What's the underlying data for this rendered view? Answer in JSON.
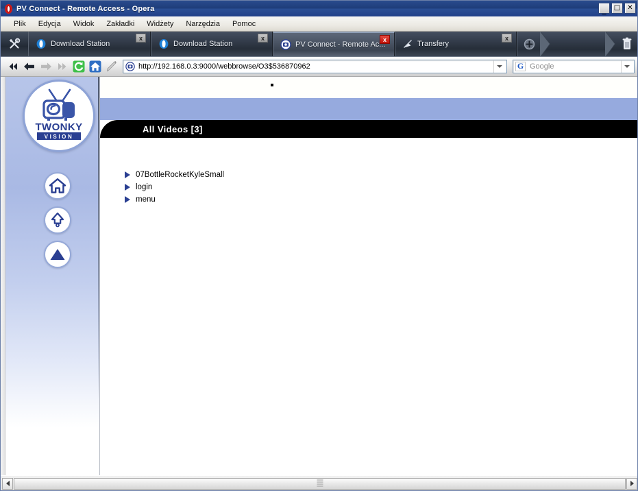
{
  "window": {
    "title": "PV Connect - Remote Access - Opera",
    "icon": "opera-logo-icon",
    "controls": {
      "minimize": "_",
      "maximize": "□",
      "close": "✕"
    }
  },
  "menubar": {
    "items": [
      {
        "label": "Plik"
      },
      {
        "label": "Edycja"
      },
      {
        "label": "Widok"
      },
      {
        "label": "Zakładki"
      },
      {
        "label": "Widżety"
      },
      {
        "label": "Narzędzia"
      },
      {
        "label": "Pomoc"
      }
    ]
  },
  "tabbar": {
    "tools_icon": "wrench-screwdriver-icon",
    "newtab_icon": "plus-circle-icon",
    "trash_icon": "trash-icon",
    "close_label": "x",
    "tabs": [
      {
        "label": "Download Station",
        "icon": "opera-favicon-icon",
        "active": false
      },
      {
        "label": "Download Station",
        "icon": "opera-favicon-icon",
        "active": false
      },
      {
        "label": "PV Connect - Remote Ac...",
        "icon": "twonky-favicon-icon",
        "active": true
      },
      {
        "label": "Transfery",
        "icon": "satellite-dish-icon",
        "active": false
      }
    ]
  },
  "navbar": {
    "buttons": [
      {
        "name": "rewind-button",
        "icon": "double-left-arrow-icon",
        "enabled": true
      },
      {
        "name": "back-button",
        "icon": "left-arrow-icon",
        "enabled": true
      },
      {
        "name": "forward-button",
        "icon": "right-arrow-icon",
        "enabled": false
      },
      {
        "name": "fast-forward-button",
        "icon": "double-right-arrow-icon",
        "enabled": false
      },
      {
        "name": "reload-button",
        "icon": "reload-icon",
        "enabled": true
      },
      {
        "name": "home-button",
        "icon": "home-icon",
        "enabled": true
      },
      {
        "name": "edit-button",
        "icon": "pencil-icon",
        "enabled": true
      }
    ],
    "address": {
      "value": "http://192.168.0.3:9000/webbrowse/O3$536870962",
      "favicon": "twonky-favicon-icon"
    },
    "search": {
      "engine": "G",
      "placeholder": "Google",
      "value": ""
    }
  },
  "page": {
    "logo": {
      "brand_top": "TWONKY",
      "brand_bottom": "V I S I O N",
      "icon": "twonky-tv-logo-icon"
    },
    "sidebar_buttons": [
      {
        "name": "home-button",
        "icon": "home-icon"
      },
      {
        "name": "up-level-button",
        "icon": "up-arrow-icon"
      },
      {
        "name": "back-button",
        "icon": "solid-up-triangle-icon"
      }
    ],
    "header_title": "All Videos [3]",
    "items": [
      {
        "label": "07BottleRocketKyleSmall"
      },
      {
        "label": "login"
      },
      {
        "label": "menu"
      }
    ],
    "stray_dot": "."
  },
  "scrollbar": {
    "left_icon": "left-arrow-icon",
    "right_icon": "right-arrow-icon"
  },
  "colors": {
    "titlebar": "#21408a",
    "tabbar": "#2e3744",
    "accent_blue": "#96aade",
    "brand_blue": "#2a3f92",
    "header_black": "#000000",
    "close_red": "#c01208"
  }
}
